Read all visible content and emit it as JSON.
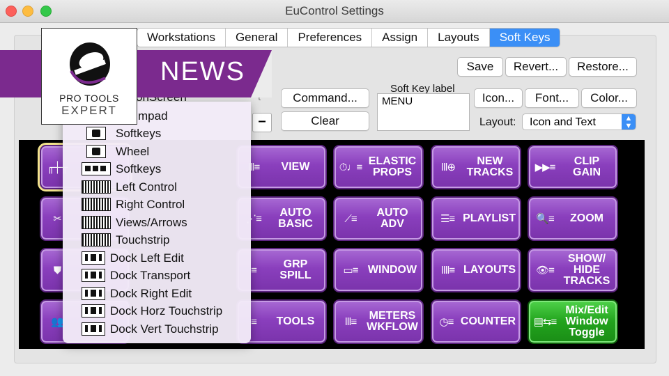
{
  "window": {
    "title": "EuControl Settings"
  },
  "tabs": [
    "Workstations",
    "General",
    "Preferences",
    "Assign",
    "Layouts",
    "Soft Keys"
  ],
  "active_tab": "Soft Keys",
  "toolbar": {
    "save": "Save",
    "revert": "Revert...",
    "restore": "Restore..."
  },
  "controls": {
    "command": "Command...",
    "clear": "Clear",
    "softkey_label_caption": "Soft Key label",
    "softkey_label_value": "MENU",
    "icon": "Icon...",
    "font": "Font...",
    "color": "Color...",
    "layout_label": "Layout:",
    "layout_value": "Icon and Text",
    "minus": "–",
    "ghost_text": "t",
    "partial_left": "onScreen",
    "partial_left2": "mpad"
  },
  "menu_items": [
    {
      "label": "Softkeys",
      "icon": "camera-device-icon"
    },
    {
      "label": "Wheel",
      "icon": "camera-device-icon"
    },
    {
      "label": "Softkeys",
      "icon": "keypad-device-icon"
    },
    {
      "label": "Left Control",
      "icon": "fader-bank-icon"
    },
    {
      "label": "Right Control",
      "icon": "fader-bank-icon"
    },
    {
      "label": "Views/Arrows",
      "icon": "fader-bank-icon"
    },
    {
      "label": "Touchstrip",
      "icon": "fader-bank-icon"
    },
    {
      "label": "Dock Left Edit",
      "icon": "dock-icon"
    },
    {
      "label": "Dock Transport",
      "icon": "dock-icon"
    },
    {
      "label": "Dock Right Edit",
      "icon": "dock-icon"
    },
    {
      "label": "Dock Horz Touchstrip",
      "icon": "dock-icon"
    },
    {
      "label": "Dock Vert Touchstrip",
      "icon": "dock-icon"
    }
  ],
  "soft_keys": [
    {
      "label": "",
      "icon": "╓┼╥",
      "selected": true
    },
    {
      "label": "",
      "icon": "",
      "hidden": true
    },
    {
      "label": "VIEW",
      "icon": "ǀǀǀ≡"
    },
    {
      "label": "ELASTIC\nPROPS",
      "icon": "⏱♩≡"
    },
    {
      "label": "NEW\nTRACKS",
      "icon": "ǀǀǀ⊕"
    },
    {
      "label": "CLIP\nGAIN",
      "icon": "▶▶≡"
    },
    {
      "label": "",
      "icon": "✂"
    },
    {
      "label": "",
      "icon": "",
      "hidden": true
    },
    {
      "label": "AUTO\nBASIC",
      "icon": "⋰≡"
    },
    {
      "label": "AUTO\nADV",
      "icon": "⟋≡"
    },
    {
      "label": "PLAYLIST",
      "icon": "☰≡"
    },
    {
      "label": "ZOOM",
      "icon": "🔍≡"
    },
    {
      "label": "",
      "icon": "⛊"
    },
    {
      "label": "",
      "icon": "",
      "hidden": true
    },
    {
      "label": "GRP\nSPILL",
      "icon": "≡"
    },
    {
      "label": "WINDOW",
      "icon": "▭≡"
    },
    {
      "label": "LAYOUTS",
      "icon": "ǀǀǀǀ≡"
    },
    {
      "label": "SHOW/\nHIDE\nTRACKS",
      "icon": "👁≡"
    },
    {
      "label": "",
      "icon": "👥"
    },
    {
      "label": "",
      "icon": "",
      "hidden": true
    },
    {
      "label": "TOOLS",
      "icon": "≡"
    },
    {
      "label": "METERS\nWKFLOW",
      "icon": "ǀǀǀ≡"
    },
    {
      "label": "COUNTER",
      "icon": "◷≡"
    },
    {
      "label": "Mix/Edit\nWindow\nToggle",
      "icon": "▤⇆≡",
      "green": true
    }
  ],
  "overlay": {
    "news": "NEWS",
    "brand_line1": "PRO TOOLS",
    "brand_line2": "EXPERT"
  },
  "colors": {
    "purple_key": "#8a3fbd",
    "green_key": "#22a31d",
    "accent": "#3b8ff6",
    "news_banner": "#7b2a8e"
  }
}
